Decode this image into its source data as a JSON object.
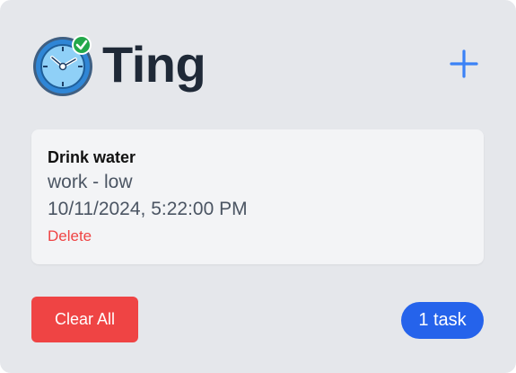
{
  "header": {
    "app_title": "Ting",
    "logo_icon": "stopwatch-check-icon",
    "add_icon": "plus-icon"
  },
  "tasks": [
    {
      "title": "Drink water",
      "meta": "work - low",
      "date": "10/11/2024, 5:22:00 PM",
      "delete_label": "Delete"
    }
  ],
  "footer": {
    "clear_label": "Clear All",
    "count_label": "1 task"
  },
  "colors": {
    "panel_bg": "#e5e7eb",
    "accent_blue": "#2563eb",
    "danger_red": "#ef4444"
  }
}
